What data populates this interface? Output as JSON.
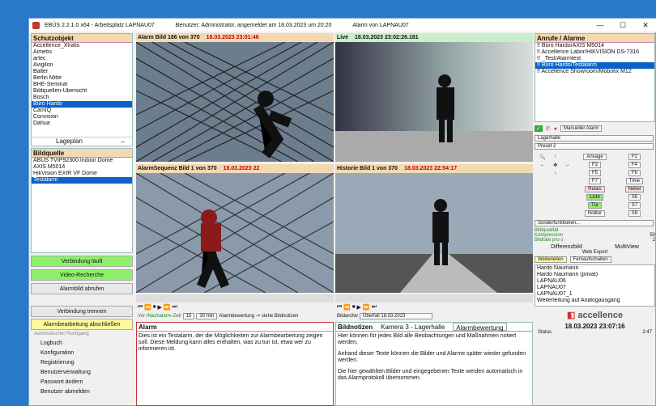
{
  "titlebar": {
    "app": "EBÜS 2.2.1.0 x64 - Arbeitsplatz LAPNAU07",
    "user": "Benutzer: Administrator, angemeldet am 18.03.2023 um 20:20",
    "alarm": "Alarm von LAPNAU07",
    "min": "—",
    "max": "☐",
    "close": "✕"
  },
  "left": {
    "schutz_title": "Schutzobjekt",
    "schutz": [
      "Accellence_Xtralis",
      "Aimetis",
      "artec",
      "Avigilon",
      "Balter",
      "Berlin Mitte",
      "BHE-Seminar",
      "Bildquellen-Übersicht",
      "Bosch",
      "Büro Hardo",
      "CamIQ",
      "Convision",
      "Dahua"
    ],
    "lageplan": "Lageplan",
    "arrow": "→",
    "bildq_title": "Bildquelle",
    "bildq": [
      "ABUS TVIP92300 Indoor Dome",
      "AXIS M5014",
      "HikVision EXIR VF Dome",
      "Testalarm"
    ],
    "verbindung_laeuft": "Verbindung läuft",
    "video_recherche": "Video-Recherche",
    "alarmbild": "Alarmbild abrufen",
    "verbindung_trennen": "Verbindung trennen",
    "alarmbearbeitung": "Alarmbearbeitung abschließen",
    "automatisch": "Automatischer Rundgang",
    "menu": [
      "Logbuch",
      "Konfiguration",
      "Registrierung",
      "Benutzerverwaltung",
      "Passwort ändern",
      "Benutzer abmelden"
    ]
  },
  "videos": {
    "v1": "Alarm Bild 186 von 370",
    "v1t": "18.03.2023 23:01:46",
    "v2": "Live",
    "v2t": "18.03.2023 23:02:26.181",
    "v3": "AlarmSequenz Bild 1 von 370",
    "v3t": "18.03.2023 22",
    "v4": "Historie Bild 1 von 370",
    "v4t": "18.03.2023 22:54:17"
  },
  "bottom": {
    "vor": "Vor-/Nachalarm-Zeit",
    "vor_val": "15",
    "sec": "30 min",
    "bewertung": "Alarmbewertung -> siehe Bildnotizen",
    "bildarchiv": "Bildarchiv",
    "bildarchiv_val": "Überfall 18.03.2023",
    "alarm_title": "Alarm",
    "alarm_text": "Dies ist ein Testalarm, der die Möglichkeiten zur Alarmbearbeitung zeigen soll. Diese Meldung kann alles enthalten, was zu tun ist, etwa wer zu informieren ist.",
    "notizen_title": "Bildnotizen",
    "kamera": "Kamera 3 - Lagerhalle",
    "alarmbew": "Alarmbewertung",
    "notizen_text": [
      "Hier können für jedes Bild alle Beobachtungen und Maßnahmen notiert werden.",
      "Anhand dieser Texte können die Bilder und Alarme später wieder gefunden werden.",
      "Die hier gewählten Bilder und eingegebenen Texte werden automatisch in das Alarmprotokoll übernommen."
    ]
  },
  "right": {
    "anrufe_title": "Anrufe / Alarme",
    "anrufe": [
      "!! Büro Hardo/AXIS M5014",
      "!! Accellence Labor/HIKVISION DS-7316",
      "!! _Test/Alarmtest",
      "!! Büro Hardo/Testalarm",
      "!! Accellence Showroom/Mobotix M12"
    ],
    "manueller": "Manueller Alarm",
    "lagerhalle": "Lagerhalle",
    "preset": "Preset 2",
    "ansage": "Ansage",
    "f2": "F2",
    "f3": "F3",
    "f4": "F4",
    "f5": "F5",
    "f6": "F6",
    "f7": "F7",
    "time": "Time",
    "relais": "Relais",
    "nebel": "Nebel",
    "licht": "Licht",
    "s6": "S6",
    "tuer": "Tür",
    "s7": "S7",
    "rolltor": "Rolltor",
    "s8": "S8",
    "sonder": "Sonderfunktionen...",
    "bildqual": "Bildqualität",
    "kompression": "Kompression",
    "komp_val": "50",
    "bildrate": "Bildrate pro s",
    "bildrate_val": "2",
    "differenzbild": "Differenzbild",
    "multiview": "MultiView",
    "webexport": "Web Export",
    "weiterleiten": "Weiterleiten",
    "fernaus": "Fernaufschalten",
    "contacts": [
      "Hardo Naumann",
      "Hardo Naumann (privat)",
      "LAPNAU06",
      "LAPNAU07",
      "LAPNAU07_1",
      "Weiterleitung auf Analogausgang"
    ],
    "logo": "accellence",
    "datetime": "18.03.2023 23:07:16",
    "status": "Status",
    "status_val": "2:47"
  }
}
